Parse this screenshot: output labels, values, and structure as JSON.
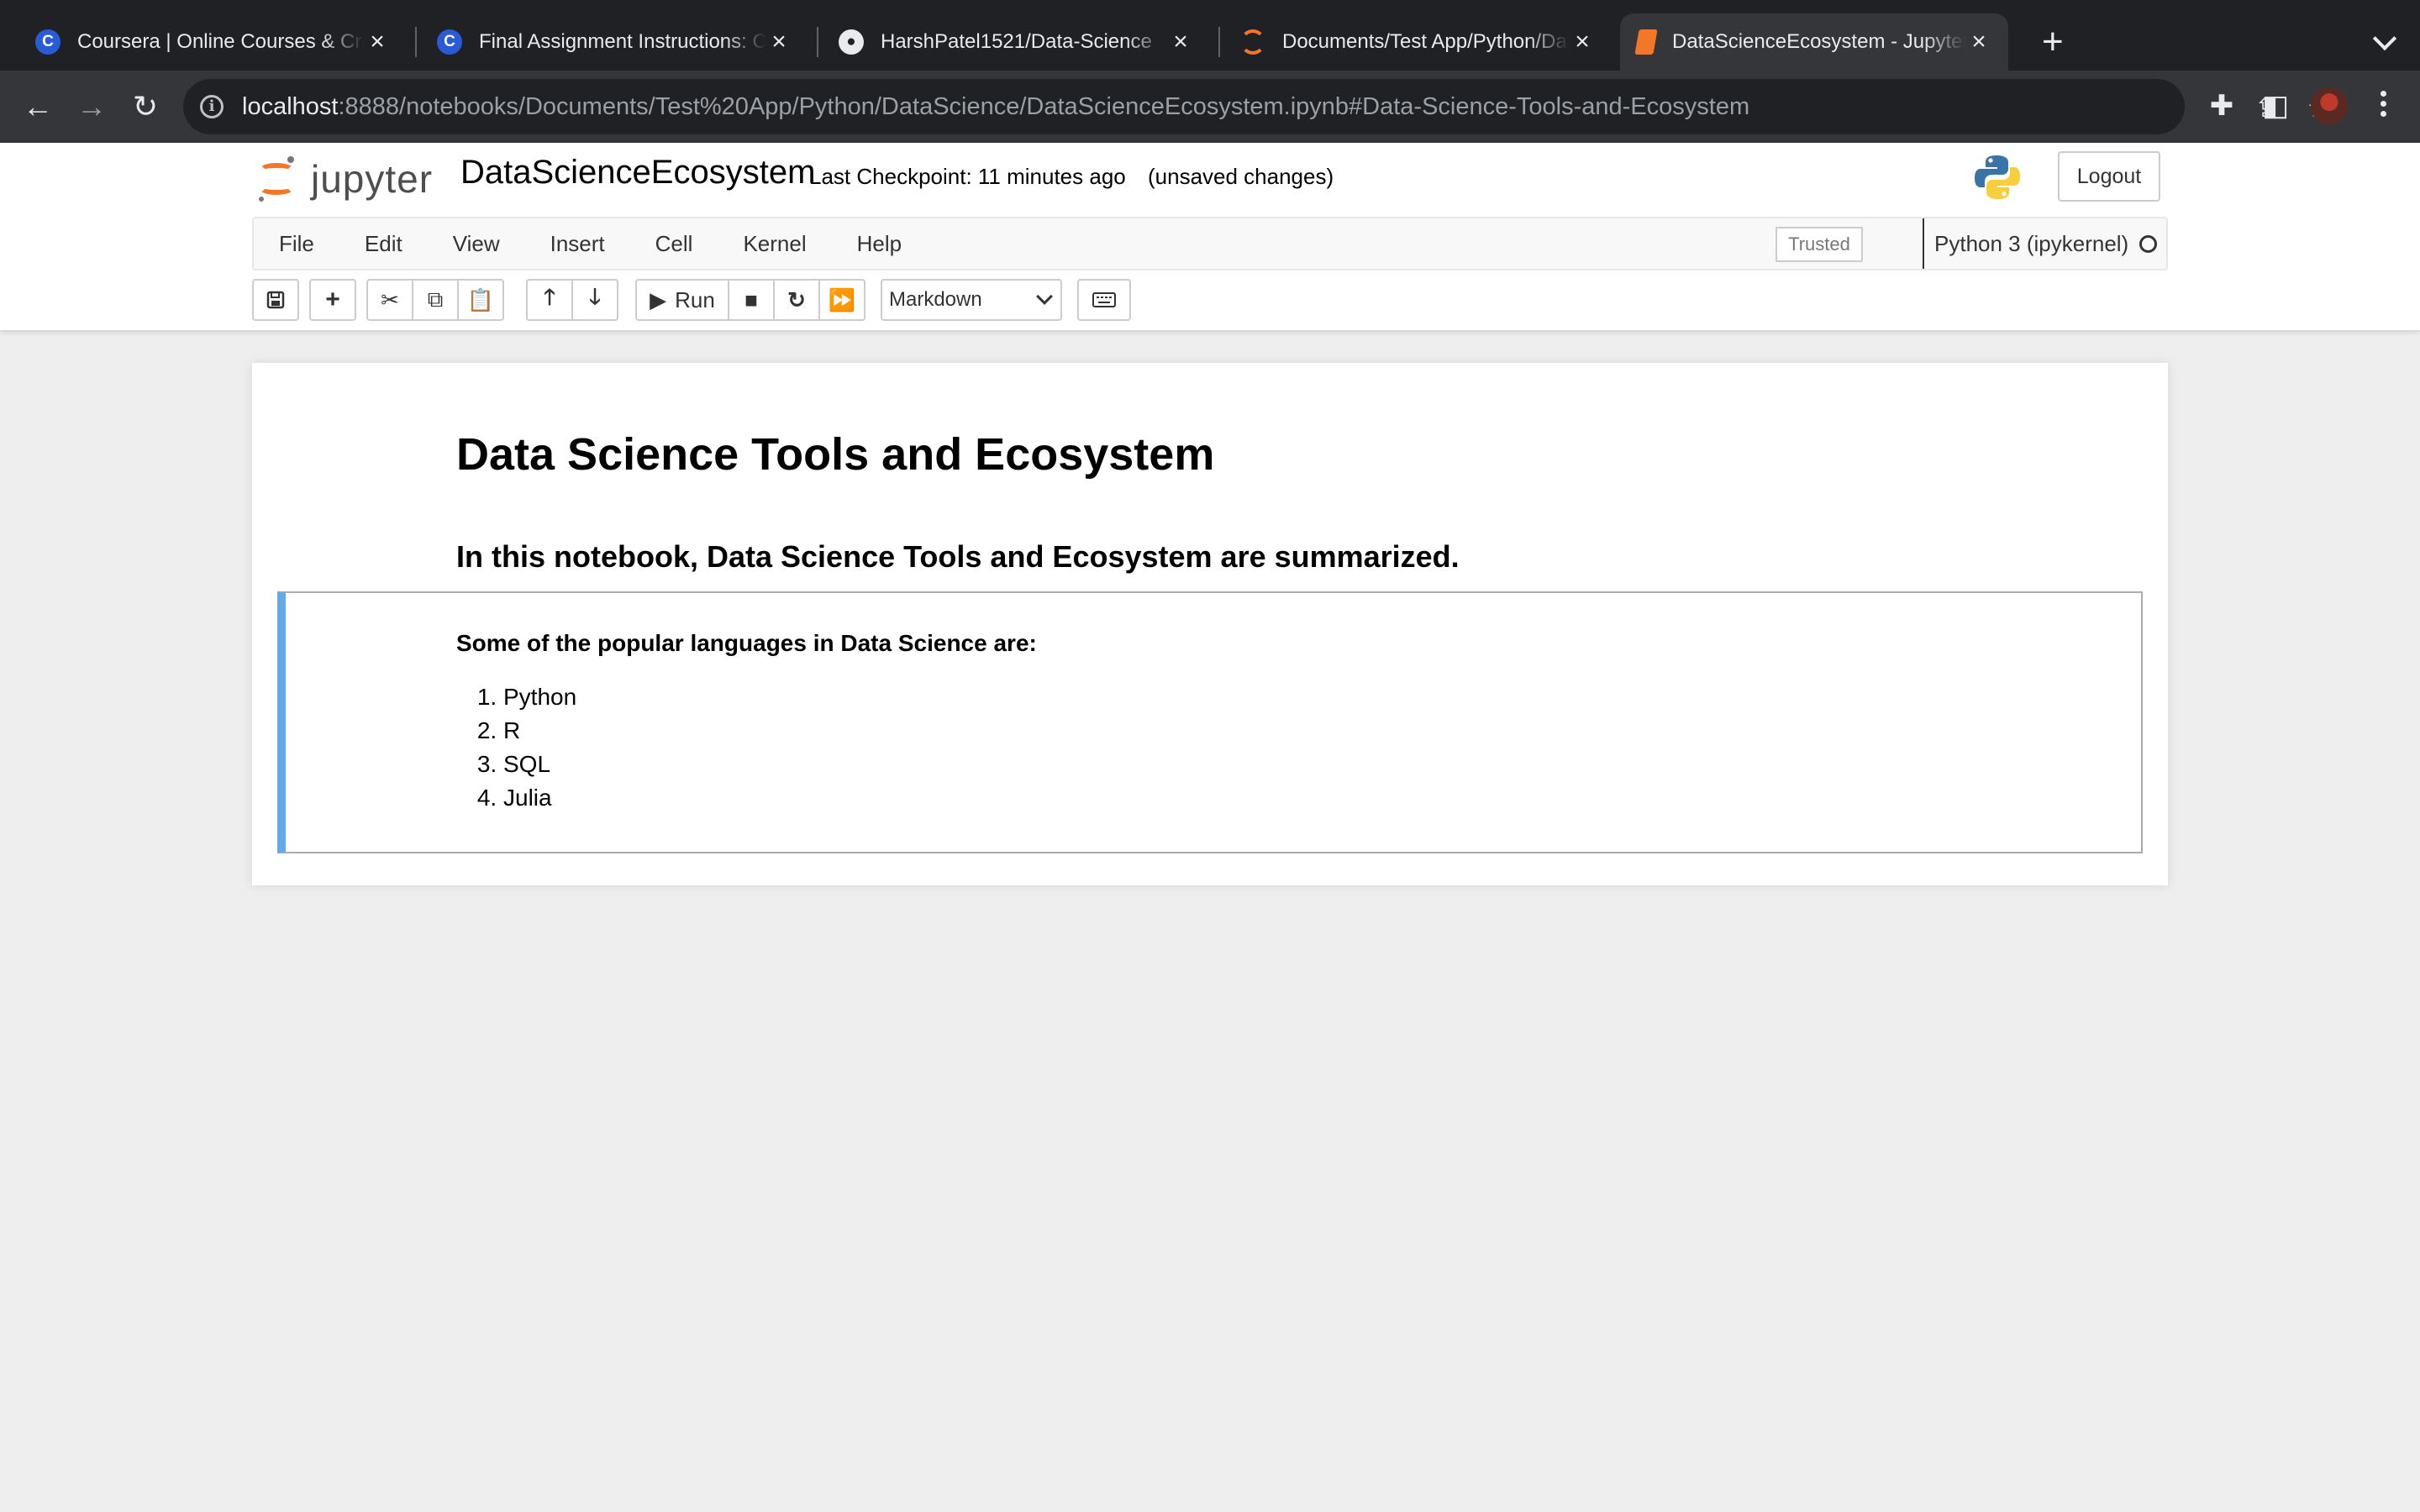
{
  "browser": {
    "tabs": [
      {
        "title": "Coursera | Online Courses & Credentials",
        "icon": "coursera-icon",
        "active": false
      },
      {
        "title": "Final Assignment Instructions: Create",
        "icon": "coursera-icon",
        "active": false
      },
      {
        "title": "HarshPatel1521/Data-Science",
        "icon": "github-icon",
        "active": false
      },
      {
        "title": "Documents/Test App/Python/DataScience/",
        "icon": "jupyter-icon",
        "active": false
      },
      {
        "title": "DataScienceEcosystem - Jupyter Notebook",
        "icon": "notebook-icon",
        "active": true
      }
    ],
    "url_host": "localhost",
    "url_rest": ":8888/notebooks/Documents/Test%20App/Python/DataScience/DataScienceEcosystem.ipynb#Data-Science-Tools-and-Ecosystem"
  },
  "jupyter": {
    "logo_text": "jupyter",
    "notebook_name": "DataScienceEcosystem",
    "checkpoint": "Last Checkpoint: 11 minutes ago",
    "autosave_status": "(unsaved changes)",
    "logout_label": "Logout",
    "menu": [
      "File",
      "Edit",
      "View",
      "Insert",
      "Cell",
      "Kernel",
      "Help"
    ],
    "trusted_label": "Trusted",
    "kernel_name": "Python 3 (ipykernel)",
    "run_label": "Run",
    "cell_type": "Markdown"
  },
  "notebook": {
    "title": "Data Science Tools and Ecosystem",
    "intro": "In this notebook, Data Science Tools and Ecosystem are summarized.",
    "languages_heading": "Some of the popular languages in Data Science are:",
    "languages": [
      "Python",
      "R",
      "SQL",
      "Julia"
    ]
  },
  "colors": {
    "jupyter_orange": "#f37726",
    "selected_cell_bar": "#66a9e7",
    "chrome_dark": "#202124",
    "chrome_toolbar": "#35363a"
  }
}
